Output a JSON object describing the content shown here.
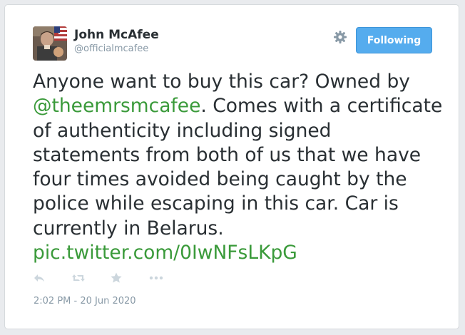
{
  "author": {
    "name": "John McAfee",
    "handle": "@officialmcafee"
  },
  "follow_button": {
    "label": "Following"
  },
  "tweet": {
    "text_before_mention": "Anyone want to buy this car? Owned by ",
    "mention": "@theemrsmcafee",
    "text_after_mention": ". Comes with a certificate of authenticity including signed statements from both of us that we have four times avoided being caught by the police while escaping in this car. Car is currently in Belarus. ",
    "link": "pic.twitter.com/0IwNFsLKpG"
  },
  "actions": [
    {
      "icon": "reply-icon"
    },
    {
      "icon": "retweet-icon"
    },
    {
      "icon": "favorite-star-icon"
    },
    {
      "icon": "more-icon"
    }
  ],
  "timestamp": "2:02 PM - 20 Jun 2020",
  "colors": {
    "link": "#3a9a3a",
    "button": "#55acee",
    "muted": "#8899a6",
    "text": "#292f33"
  }
}
